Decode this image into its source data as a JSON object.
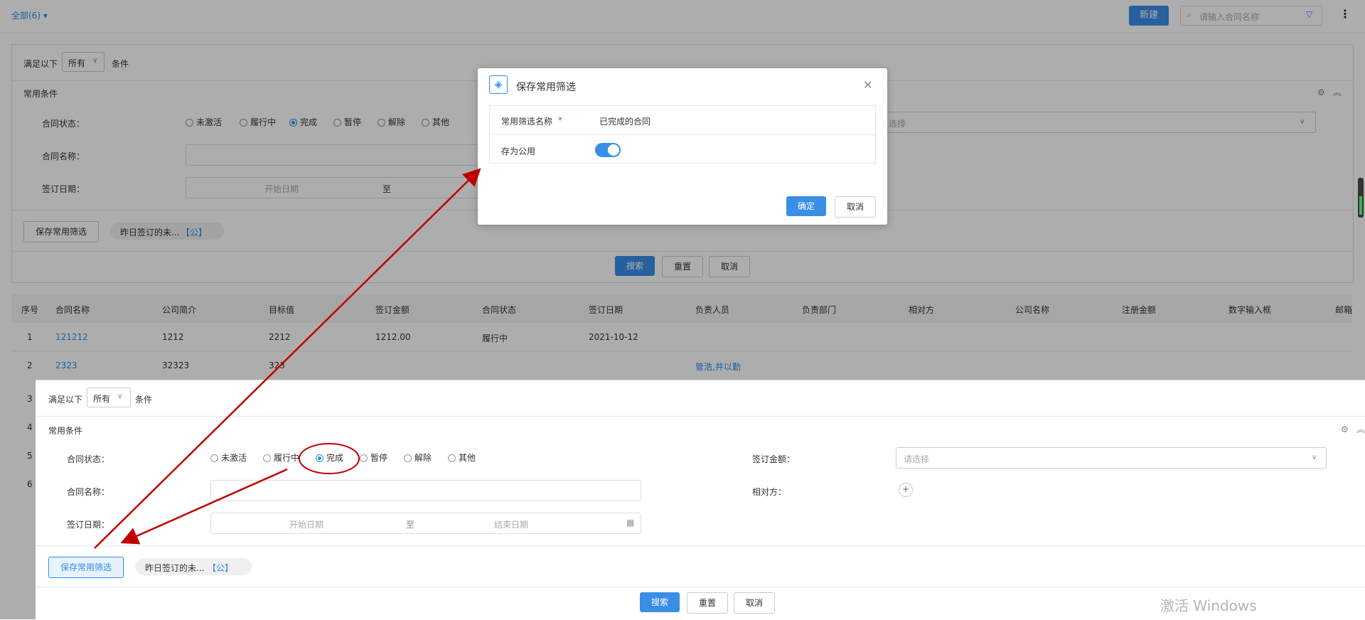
{
  "topbar": {
    "scope_label": "全部(6)",
    "new_button": "新建",
    "search_placeholder": "请输入合同名称"
  },
  "filter_bg": {
    "match_prefix": "满足以下",
    "match_value": "所有",
    "match_suffix": "条件",
    "section_title": "常用条件",
    "status_label": "合同状态：",
    "status_options": [
      "未激活",
      "履行中",
      "完成",
      "暂停",
      "解除",
      "其他"
    ],
    "status_selected": "完成",
    "name_label": "合同名称：",
    "date_label": "签订日期：",
    "date_start_placeholder": "开始日期",
    "date_sep": "至",
    "select_placeholder": "选择",
    "save_filter_button": "保存常用筛选",
    "saved_tag": "昨日签订的未...",
    "saved_tag_suffix": "【公】",
    "search_button": "搜索",
    "reset_button": "重置",
    "cancel_button": "取消"
  },
  "table": {
    "headers": [
      "序号",
      "合同名称",
      "公司简介",
      "目标值",
      "签订金额",
      "合同状态",
      "签订日期",
      "负责人员",
      "负责部门",
      "相对方",
      "公司名称",
      "注册金额",
      "数字输入框",
      "邮箱"
    ],
    "rows": [
      {
        "no": "1",
        "name": "121212",
        "intro": "1212",
        "target": "2212",
        "amount": "1212.00",
        "status": "履行中",
        "date": "2021-10-12",
        "owner": ""
      },
      {
        "no": "2",
        "name": "2323",
        "intro": "32323",
        "target": "323",
        "amount": "",
        "status": "",
        "date": "",
        "owner": "管浩,井以勤"
      }
    ],
    "hidden_row_numbers": [
      "3",
      "4",
      "5",
      "6"
    ]
  },
  "modal": {
    "title": "保存常用筛选",
    "name_label": "常用筛选名称",
    "name_value": "已完成的合同",
    "public_label": "存为公用",
    "public_on": true,
    "ok_button": "确定",
    "cancel_button": "取消"
  },
  "zoom": {
    "match_prefix": "满足以下",
    "match_value": "所有",
    "match_suffix": "条件",
    "section_title": "常用条件",
    "status_label": "合同状态：",
    "status_options": [
      "未激活",
      "履行中",
      "完成",
      "暂停",
      "解除",
      "其他"
    ],
    "status_selected": "完成",
    "amount_label": "签订金额：",
    "amount_placeholder": "请选择",
    "name_label": "合同名称：",
    "counterparty_label": "相对方：",
    "date_label": "签订日期：",
    "date_start_placeholder": "开始日期",
    "date_sep": "至",
    "date_end_placeholder": "结束日期",
    "save_filter_button": "保存常用筛选",
    "saved_tag": "昨日签订的未...",
    "saved_tag_suffix": "【公】",
    "search_button": "搜索",
    "reset_button": "重置",
    "cancel_button": "取消"
  },
  "watermark": {
    "line1": "激活 Windows"
  },
  "colors": {
    "accent": "#3a8ee6",
    "link": "#2d8cf0",
    "annotation_red": "#c00000"
  }
}
